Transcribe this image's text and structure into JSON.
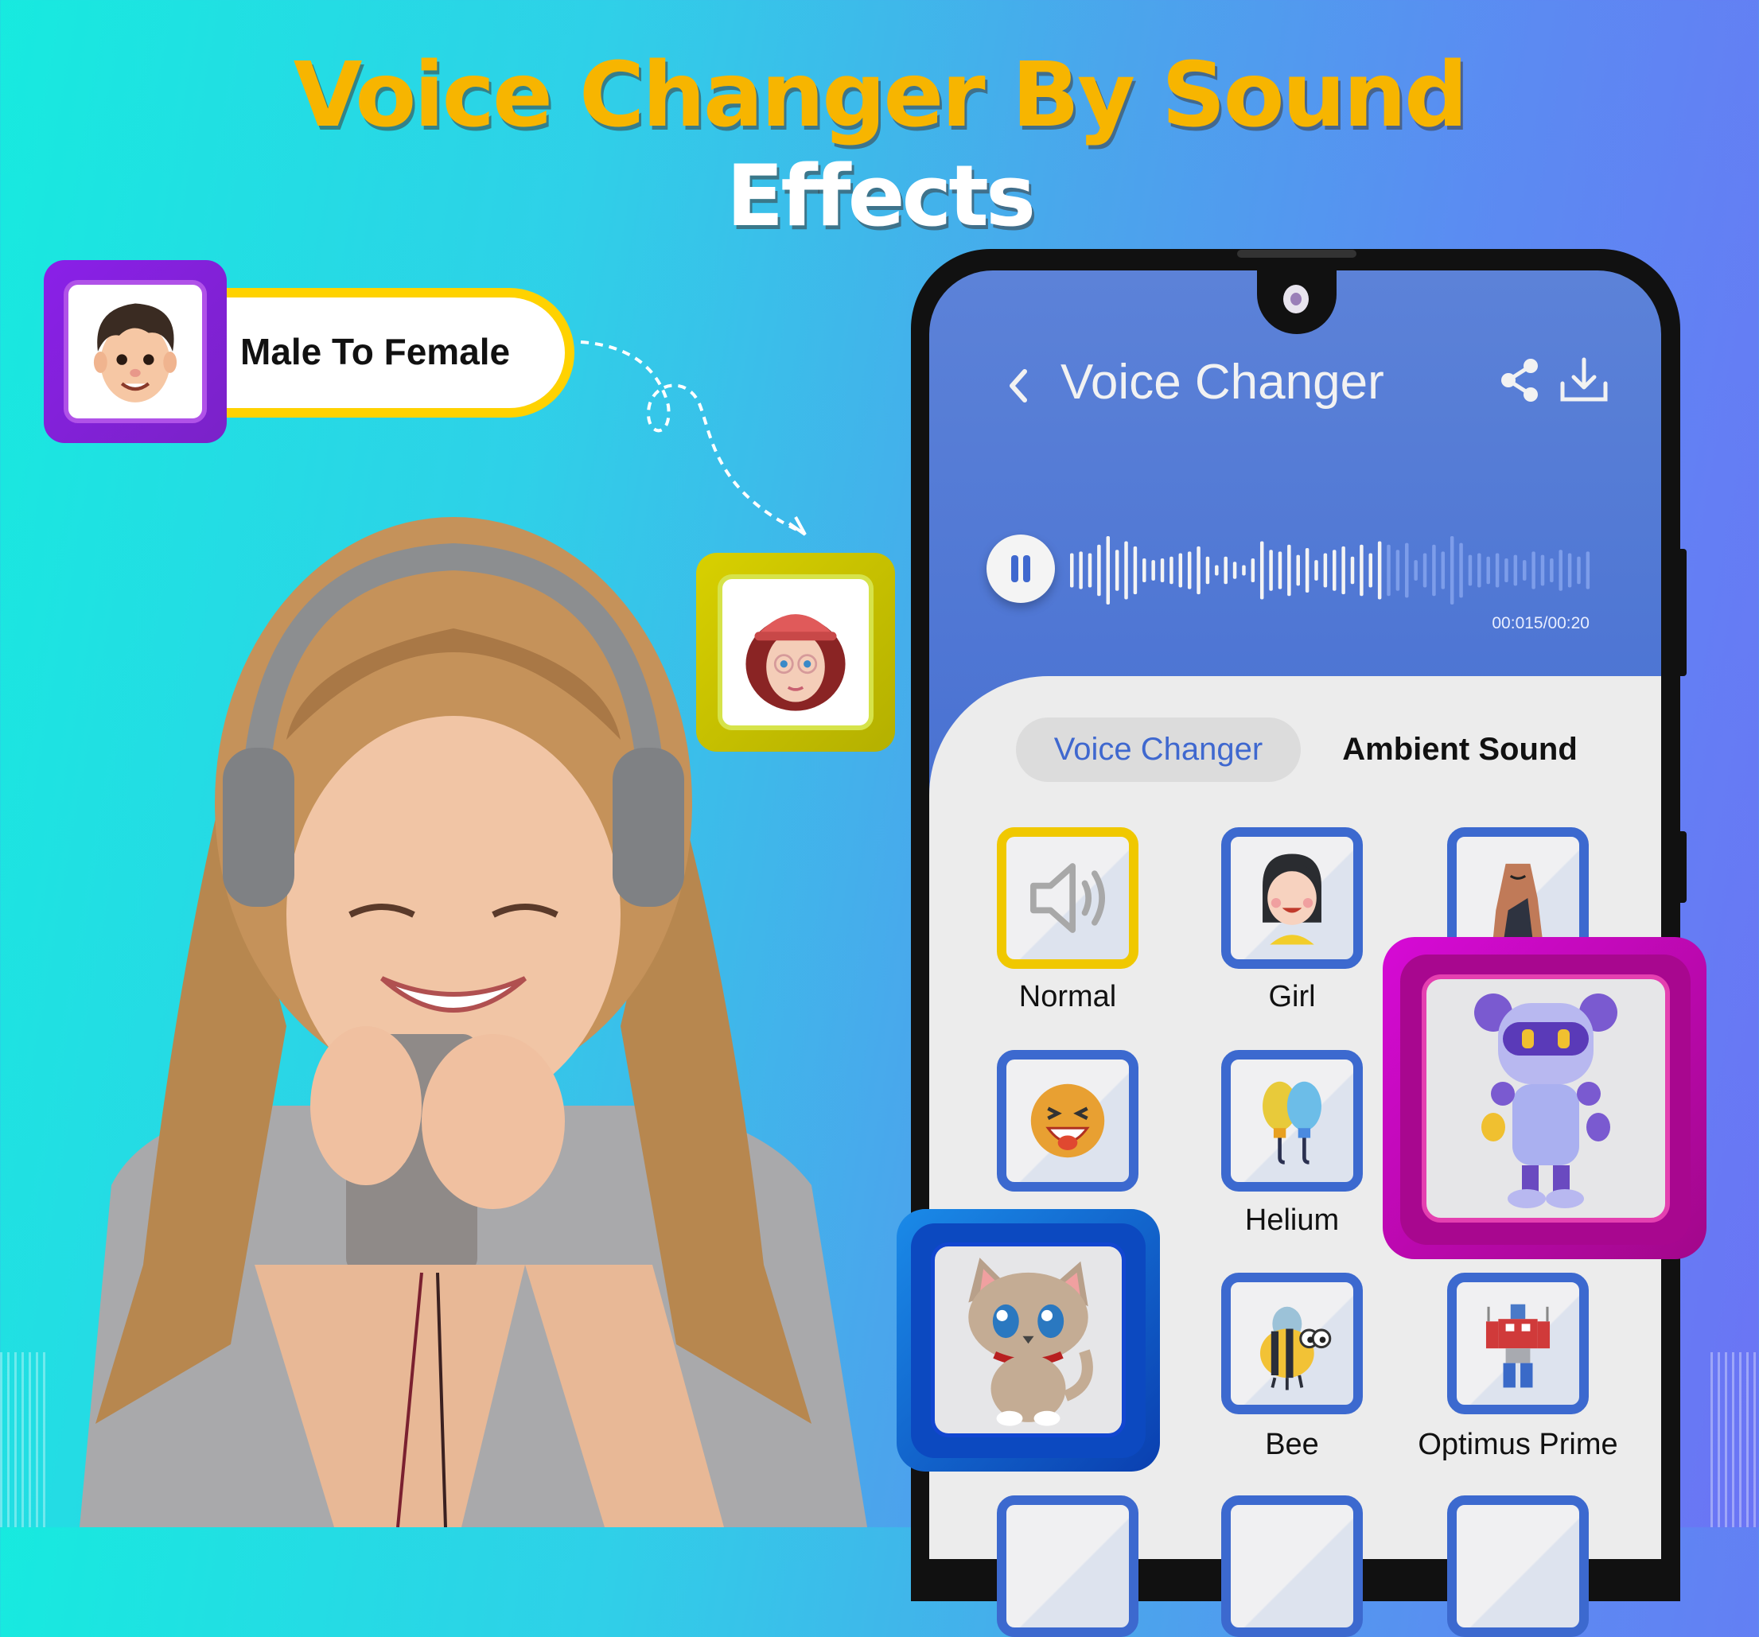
{
  "promo": {
    "headline_line1": "Voice Changer By Sound",
    "headline_line2": "Effects",
    "male_badge_label": "Male To Female",
    "male_avatar": "boy-avatar-icon",
    "female_avatar": "girl-avatar-icon",
    "colors": {
      "headline": "#f7b500",
      "headline2": "#ffffff",
      "male_badge": "#8a20e8",
      "female_badge": "#d8d000",
      "pill_border": "#ffd200"
    }
  },
  "app": {
    "header": {
      "back_icon": "chevron-left-icon",
      "title": "Voice Changer",
      "share_icon": "share-icon",
      "download_icon": "download-icon"
    },
    "player": {
      "state": "playing",
      "button_icon": "pause-icon",
      "time": "00:015/00:20",
      "progress_fraction": 0.6
    },
    "tabs": [
      {
        "label": "Voice Changer",
        "active": true
      },
      {
        "label": "Ambient Sound",
        "active": false
      }
    ],
    "effects": [
      {
        "label": "Normal",
        "icon": "speaker-icon",
        "selected": true
      },
      {
        "label": "Girl",
        "icon": "girl-face-icon",
        "selected": false
      },
      {
        "label": "",
        "icon": "cave-icon",
        "selected": false
      },
      {
        "label": "",
        "icon": "laughing-emoji-icon",
        "selected": false
      },
      {
        "label": "Helium",
        "icon": "balloons-icon",
        "selected": false
      },
      {
        "label": "",
        "icon": "robot-icon",
        "selected": false
      },
      {
        "label": "",
        "icon": "cat-icon",
        "selected": false
      },
      {
        "label": "Bee",
        "icon": "bee-icon",
        "selected": false
      },
      {
        "label": "Optimus Prime",
        "icon": "transformer-robot-icon",
        "selected": false
      }
    ],
    "colors": {
      "primary": "#3f68cf",
      "selected_tile": "#f0c800",
      "panel": "#ececec"
    }
  },
  "highlights": {
    "robot_badge": "robot-icon",
    "cat_badge": "cat-icon"
  }
}
